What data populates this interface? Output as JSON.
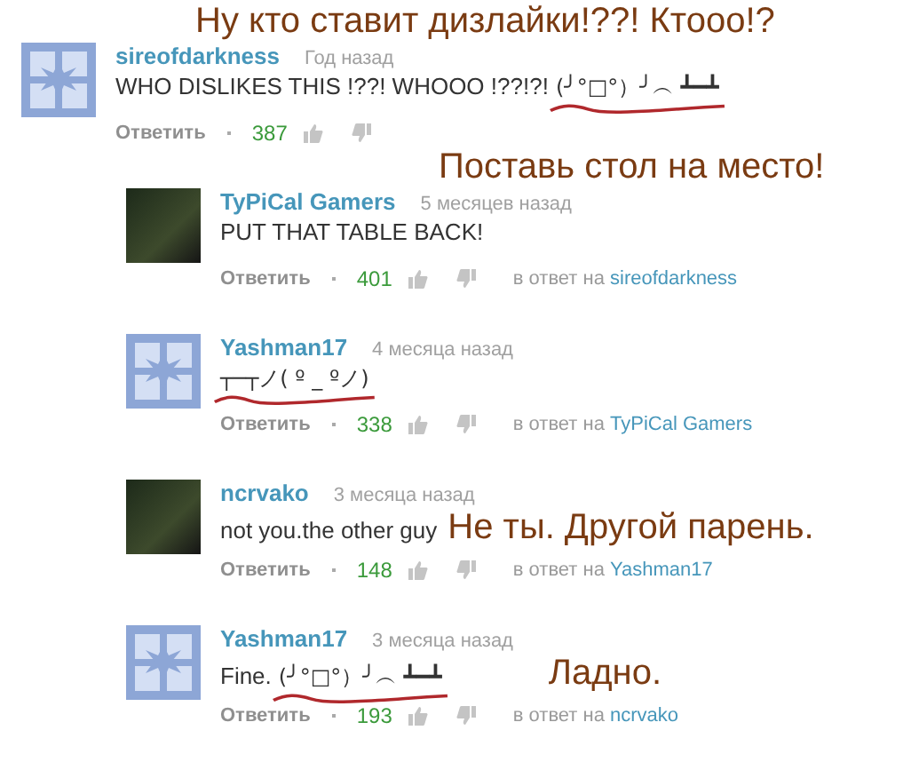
{
  "comments": [
    {
      "kind": "top",
      "avatar": {
        "kind": "default"
      },
      "author": "sireofdarkness",
      "time": "Год назад",
      "text": "WHO DISLIKES THIS !??! WHOOO !??!?!",
      "scribbled": "(╯°□°）╯︵ ┻━┻",
      "caption": {
        "kind": "overlay",
        "text": "Ну кто ставит дизлайки!??! Ктооо!?"
      },
      "reply_label": "Ответить",
      "likes": "387"
    },
    {
      "kind": "reply",
      "avatar": {
        "kind": "photo"
      },
      "author": "TyPiCal Gamers",
      "time": "5 месяцев назад",
      "text": "PUT THAT TABLE BACK!",
      "caption": {
        "kind": "overlay",
        "text": "Поставь стол на место!"
      },
      "reply_label": "Ответить",
      "likes": "401",
      "in_reply_label": "в ответ на",
      "in_reply_to": "sireofdarkness"
    },
    {
      "kind": "reply",
      "avatar": {
        "kind": "default"
      },
      "author": "Yashman17",
      "time": "4 месяца назад",
      "scribbled": "┬─┬ノ( º _ ºノ)",
      "reply_label": "Ответить",
      "likes": "338",
      "in_reply_label": "в ответ на",
      "in_reply_to": "TyPiCal Gamers"
    },
    {
      "kind": "reply",
      "avatar": {
        "kind": "photo"
      },
      "author": "ncrvako",
      "time": "3 месяца назад",
      "text": "not you.the other guy",
      "caption": {
        "kind": "inline",
        "text": "Не ты. Другой парень."
      },
      "reply_label": "Ответить",
      "likes": "148",
      "in_reply_label": "в ответ на",
      "in_reply_to": "Yashman17"
    },
    {
      "kind": "reply",
      "avatar": {
        "kind": "default"
      },
      "author": "Yashman17",
      "time": "3 месяца назад",
      "text": "Fine.",
      "scribbled": "(╯°□°）╯︵ ┻━┻",
      "caption": {
        "kind": "aside",
        "text": "Ладно."
      },
      "reply_label": "Ответить",
      "likes": "193",
      "in_reply_label": "в ответ на",
      "in_reply_to": "ncrvako"
    }
  ]
}
